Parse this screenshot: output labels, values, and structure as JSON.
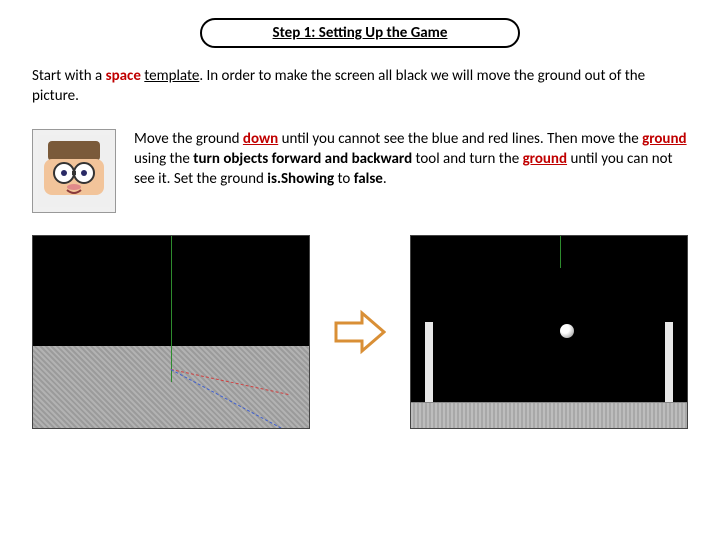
{
  "header": {
    "title": "Step 1: Setting Up the Game"
  },
  "intro": {
    "p1a": "Start with a ",
    "kw_space": "space",
    "p1b": " ",
    "kw_template": "template",
    "p1c": ". In order to make the screen all black we will move the ground out of the picture."
  },
  "instr": {
    "t1": "Move the ground ",
    "kw_down": "down",
    "t2": " until you cannot see the blue and red lines. Then move the ",
    "kw_ground1": "ground",
    "t3": " using the ",
    "kw_tool": "turn objects forward and backward",
    "t4": " tool and turn the ",
    "kw_ground2": "ground",
    "t5": " until you can not see it. Set the ground ",
    "kw_isShowing": "is.Showing",
    "t6": " to ",
    "kw_false": "false",
    "t7": "."
  },
  "images": {
    "left_alt": "Scene with ground and axes visible",
    "right_alt": "Scene with ground moved out, pong layout",
    "arrow_alt": "transition-arrow"
  }
}
